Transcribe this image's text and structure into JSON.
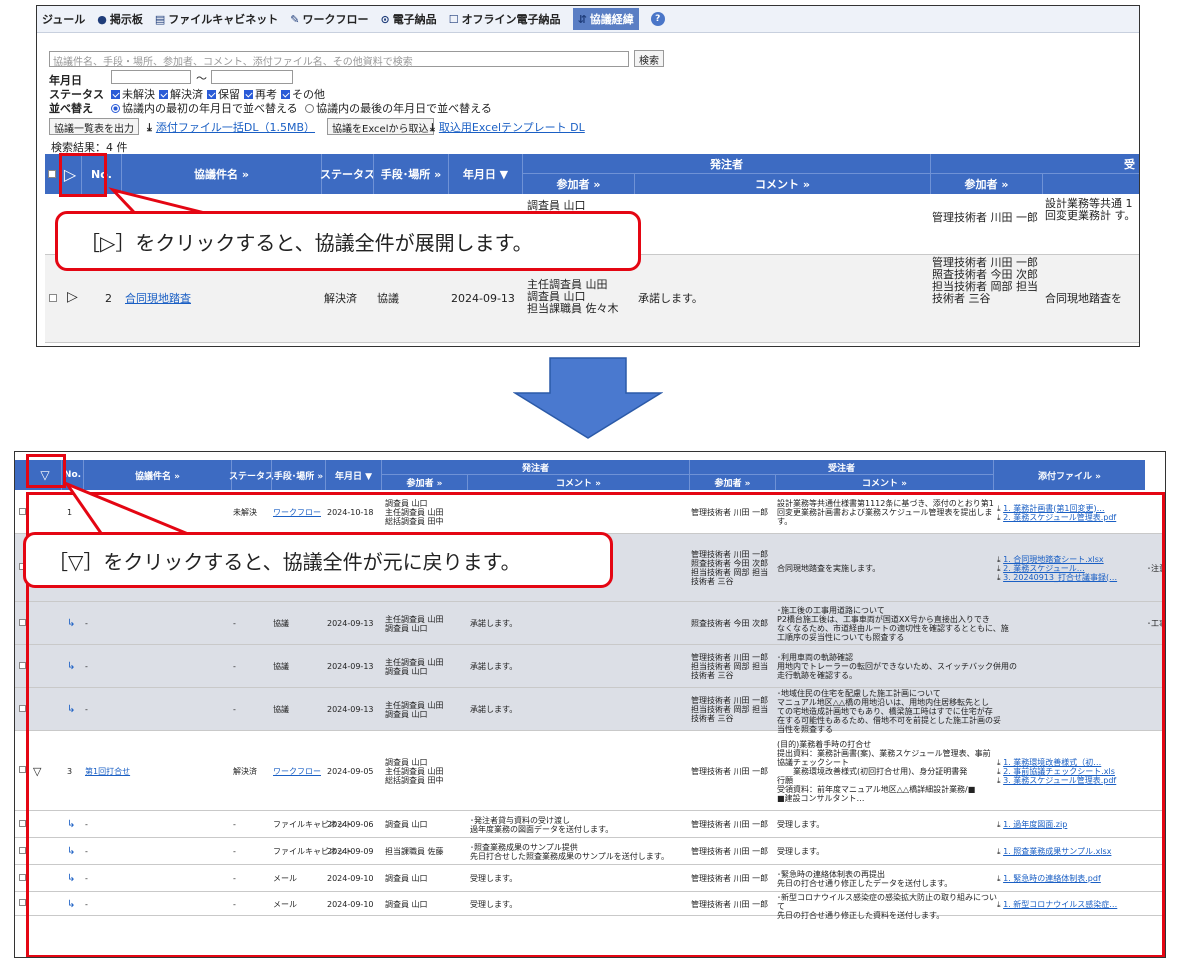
{
  "tabs": [
    {
      "icon": "",
      "label": "ジュール"
    },
    {
      "icon": "●",
      "label": "掲示板"
    },
    {
      "icon": "▤",
      "label": "ファイルキャビネット"
    },
    {
      "icon": "✎",
      "label": "ワークフロー"
    },
    {
      "icon": "⊙",
      "label": "電子納品"
    },
    {
      "icon": "☐",
      "label": "オフライン電子納品"
    },
    {
      "icon": "⇵",
      "label": "協議経緯"
    }
  ],
  "help_icon": "?",
  "search": {
    "placeholder": "協議件名、手段・場所、参加者、コメント、添付ファイル名、その他資料で検索",
    "button": "検索"
  },
  "filters": {
    "date_label": "年月日",
    "date_sep": "～",
    "status_label": "ステータス",
    "statuses": [
      "未解決",
      "解決済",
      "保留",
      "再考",
      "その他"
    ],
    "sort_label": "並べ替え",
    "sort_options": [
      "協議内の最初の年月日で並べ替える",
      "協議内の最後の年月日で並べ替える"
    ]
  },
  "actions": {
    "export": "協議一覧表を出力",
    "bulk_dl": "添付ファイル一括DL（1.5MB）",
    "import": "協議をExcelから取込",
    "template": "取込用Excelテンプレート DL"
  },
  "result_count": "検索結果：4 件",
  "headers": {
    "expand": "▷",
    "collapse": "▽",
    "no": "No.",
    "name": "協議件名 »",
    "status": "ステータス",
    "means": "手段･場所 »",
    "date": "年月日 ▼",
    "orderer": "発注者",
    "contractor": "受注者",
    "participant": "参加者 »",
    "comment": "コメント »",
    "participant2": "参加者 »",
    "comment2": "コメント »",
    "attach": "添付ファイル »",
    "contractor_cut": "受"
  },
  "top_rows": [
    {
      "mark": "",
      "no": "",
      "name": "",
      "status": "",
      "means": "",
      "date": "",
      "o_part": "調査員 山口",
      "o_comment": "",
      "c_part": "管理技術者 川田 一郎",
      "c_comment": "設計業務等共通 1回変更業務計 す。"
    },
    {
      "mark": "▷",
      "no": "2",
      "name": "合同現地踏査",
      "status": "解決済",
      "means": "協議",
      "date": "2024-09-13",
      "o_part": "主任調査員 山田\n調査員 山口\n担当課職員 佐々木",
      "o_comment": "承諾します。",
      "c_part": "管理技術者 川田 一郎\n照査技術者 今田 次郎\n担当技術者 岡部\n担当技術者 三谷",
      "c_comment": "合同現地踏査を"
    }
  ],
  "bottom_rows": [
    {
      "mark": "",
      "arrow": "",
      "no": "1",
      "name": "",
      "status": "未解決",
      "means": "ワークフロー",
      "date": "2024-10-18",
      "o_part": "調査員 山口\n主任調査員 山田\n総括調査員 田中",
      "o_comment": "",
      "c_part": "管理技術者 川田 一郎",
      "c_comment": "設計業務等共通仕様書第1112条に基づき、添付のとおり第1\n回変更業務計画書および業務スケジュール管理表を提出しま\nす。",
      "files": [
        "1. 業務計画書(第1回変更)…",
        "2. 業務スケジュール管理表.pdf"
      ],
      "extra": ""
    },
    {
      "mark": "",
      "arrow": "",
      "no": "",
      "name": "",
      "status": "",
      "means": "",
      "date": "",
      "o_part": "",
      "o_comment": "",
      "c_part": "管理技術者 川田 一郎\n照査技術者 今田 次郎\n担当技術者 岡部\n担当技術者 三谷",
      "c_comment": "合同現地踏査を実施します。",
      "files": [
        "1. 合同現地踏査シート.xlsx",
        "2. 業務スケジュール…",
        "3. 20240913_打合せ議事録(…"
      ],
      "extra": "･注意"
    },
    {
      "mark": "",
      "arrow": "↳",
      "no": "",
      "name": "-",
      "status": "-",
      "means": "協議",
      "date": "2024-09-13",
      "o_part": "主任調査員 山田\n調査員 山口",
      "o_comment": "承諾します。",
      "c_part": "照査技術者 今田 次郎",
      "c_comment": "･施工後の工事用道路について\nP2橋台施工後は、工事車両が国道XX号から直接出入りでき\nなくなるため、市道経由ルートの適切性を確認するとともに、施\n工順序の妥当性についても照査する",
      "files": [],
      "extra": "･工事"
    },
    {
      "mark": "",
      "arrow": "↳",
      "no": "",
      "name": "-",
      "status": "-",
      "means": "協議",
      "date": "2024-09-13",
      "o_part": "主任調査員 山田\n調査員 山口",
      "o_comment": "承諾します。",
      "c_part": "管理技術者 川田 一郎\n担当技術者 岡部\n担当技術者 三谷",
      "c_comment": "･利用車両の軌跡確認\n用地内でトレーラーの転回ができないため、スイッチバック併用の\n走行軌跡を確認する。",
      "files": [],
      "extra": ""
    },
    {
      "mark": "",
      "arrow": "↳",
      "no": "",
      "name": "-",
      "status": "-",
      "means": "協議",
      "date": "2024-09-13",
      "o_part": "主任調査員 山田\n調査員 山口",
      "o_comment": "承諾します。",
      "c_part": "管理技術者 川田 一郎\n担当技術者 岡部\n担当技術者 三谷",
      "c_comment": "･地域住民の住宅を配慮した施工計画について\nマニュアル地区△△橋の用地沿いは、用地内住居移転先とし\nての宅地造成計画地でもあり、橋梁施工時はすでに住宅が存\n在する可能性もあるため、借地不可を前提とした施工計画の妥\n当性を照査する",
      "files": [],
      "extra": ""
    },
    {
      "mark": "▽",
      "arrow": "",
      "no": "3",
      "name": "第1回打合せ",
      "status": "解決済",
      "means": "ワークフロー",
      "date": "2024-09-05",
      "o_part": "調査員 山口\n主任調査員 山田\n総括調査員 田中",
      "o_comment": "",
      "c_part": "管理技術者 川田 一郎",
      "c_comment": "(目的)業務着手時の打合せ\n提出資料：業務計画書(案)、業務スケジュール管理表、事前\n協議チェックシート\n　　業務環境改善様式(初回打合せ用)、身分証明書発\n行願\n受領資料：前年度マニュアル地区△△橋詳細設計業務/■\n■建設コンサルタント…",
      "files": [
        "1. 業務環境改善様式（初…",
        "2. 事前協議チェックシート.xls",
        "3. 業務スケジュール管理表.pdf"
      ],
      "extra": ""
    },
    {
      "mark": "",
      "arrow": "↳",
      "no": "",
      "name": "-",
      "status": "-",
      "means": "ファイルキャビネット",
      "date": "2024-09-06",
      "o_part": "調査員 山口",
      "o_comment": "･発注者貸与資料の受け渡し\n過年度業務の図面データを送付します。",
      "c_part": "管理技術者 川田 一郎",
      "c_comment": "受理します。",
      "files": [
        "1. 過年度図面.zip"
      ],
      "extra": ""
    },
    {
      "mark": "",
      "arrow": "↳",
      "no": "",
      "name": "-",
      "status": "-",
      "means": "ファイルキャビネット",
      "date": "2024-09-09",
      "o_part": "担当課職員 佐藤",
      "o_comment": "･照査業務成果のサンプル提供\n先日打合せした照査業務成果のサンプルを送付します。",
      "c_part": "管理技術者 川田 一郎",
      "c_comment": "受理します。",
      "files": [
        "1. 照査業務成果サンプル.xlsx"
      ],
      "extra": ""
    },
    {
      "mark": "",
      "arrow": "↳",
      "no": "",
      "name": "-",
      "status": "-",
      "means": "メール",
      "date": "2024-09-10",
      "o_part": "調査員 山口",
      "o_comment": "受理します。",
      "c_part": "管理技術者 川田 一郎",
      "c_comment": "･緊急時の連絡体制表の再提出\n先日の打合せ通り修正したデータを送付します。",
      "files": [
        "1. 緊急時の連絡体制表.pdf"
      ],
      "extra": ""
    },
    {
      "mark": "",
      "arrow": "↳",
      "no": "",
      "name": "-",
      "status": "-",
      "means": "メール",
      "date": "2024-09-10",
      "o_part": "調査員 山口",
      "o_comment": "受理します。",
      "c_part": "管理技術者 川田 一郎",
      "c_comment": "･新型コロナウイルス感染症の感染拡大防止の取り組みについ\nて\n先日の打合せ通り修正した資料を送付します。",
      "files": [
        "1. 新型コロナウイルス感染症…"
      ],
      "extra": ""
    }
  ],
  "callout1": "［▷］をクリックすると、協議全件が展開します。",
  "callout2": "［▽］をクリックすると、協議全件が元に戻ります。",
  "colors": {
    "header": "#3d6bc2",
    "highlight": "#e40613",
    "arrow": "#4a79cf",
    "grey_row": "#dcdfe6"
  }
}
